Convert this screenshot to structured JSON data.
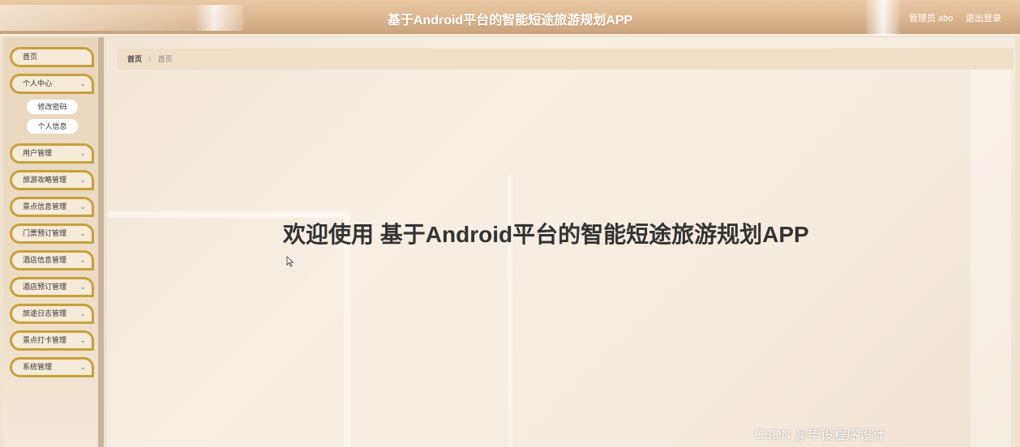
{
  "header": {
    "title": "基于Android平台的智能短途旅游规划APP",
    "user_label": "管理员 abo",
    "logout_label": "退出登录"
  },
  "sidebar": {
    "items": [
      {
        "label": "首页",
        "has_chevron": false
      },
      {
        "label": "个人中心",
        "has_chevron": true
      },
      {
        "label": "用户管理",
        "has_chevron": true
      },
      {
        "label": "旅游攻略管理",
        "has_chevron": true
      },
      {
        "label": "景点信息管理",
        "has_chevron": true
      },
      {
        "label": "门票预订管理",
        "has_chevron": true
      },
      {
        "label": "酒店信息管理",
        "has_chevron": true
      },
      {
        "label": "酒店预订管理",
        "has_chevron": true
      },
      {
        "label": "旅途日志管理",
        "has_chevron": true
      },
      {
        "label": "景点打卡管理",
        "has_chevron": true
      },
      {
        "label": "系统管理",
        "has_chevron": true
      }
    ],
    "subitems": [
      {
        "label": "修改密码"
      },
      {
        "label": "个人信息"
      }
    ]
  },
  "breadcrumb": {
    "home": "首页",
    "separator": "/",
    "current": "首页"
  },
  "main": {
    "welcome": "欢迎使用 基于Android平台的智能短途旅游规划APP"
  },
  "watermark": "CSDN @毕设程序设计",
  "colors": {
    "accent_border": "#c8a03b",
    "header_bg": "#dcb690",
    "sidebar_bg": "#e9d6bd"
  }
}
